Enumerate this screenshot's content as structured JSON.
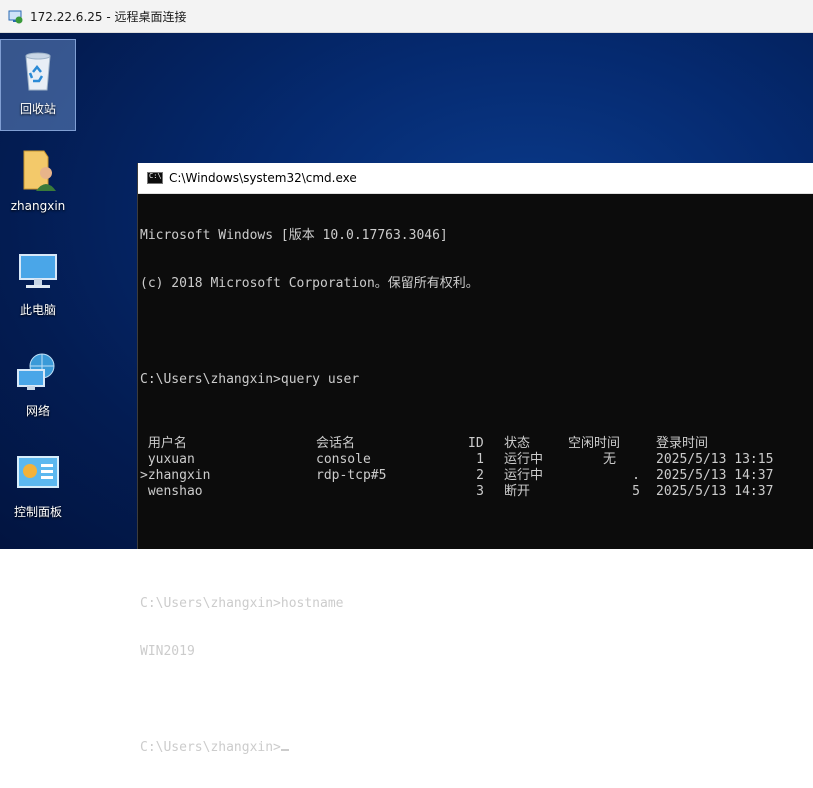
{
  "rdp": {
    "title": "172.22.6.25 - 远程桌面连接"
  },
  "desktop": {
    "icons": [
      {
        "label": "回收站",
        "icon": "recycle-bin-icon"
      },
      {
        "label": "zhangxin",
        "icon": "user-folder-icon"
      },
      {
        "label": "此电脑",
        "icon": "computer-icon"
      },
      {
        "label": "网络",
        "icon": "network-icon"
      },
      {
        "label": "控制面板",
        "icon": "control-panel-icon"
      }
    ]
  },
  "cmd": {
    "title": "C:\\Windows\\system32\\cmd.exe",
    "lines": {
      "version": "Microsoft Windows [版本 10.0.17763.3046]",
      "copyright": "(c) 2018 Microsoft Corporation。保留所有权利。",
      "cmd1": "C:\\Users\\zhangxin>query user",
      "cmd2": "C:\\Users\\zhangxin>hostname",
      "hostname_output": "WIN2019",
      "prompt": "C:\\Users\\zhangxin>"
    },
    "query_user": {
      "headers": {
        "username": " 用户名",
        "session": "会话名",
        "id": "ID",
        "state": "状态",
        "idle": "空闲时间",
        "logon": "登录时间"
      },
      "rows": [
        {
          "username": " yuxuan",
          "session": "console",
          "id": "1",
          "state": "运行中",
          "idle": "无",
          "logon": "2025/5/13 13:15"
        },
        {
          "username": ">zhangxin",
          "session": "rdp-tcp#5",
          "id": "2",
          "state": "运行中",
          "idle": ".",
          "logon": "2025/5/13 14:37"
        },
        {
          "username": " wenshao",
          "session": "",
          "id": "3",
          "state": "断开",
          "idle": "5",
          "logon": "2025/5/13 14:37"
        }
      ]
    }
  },
  "colors": {
    "console_bg": "#0c0c0c",
    "console_fg": "#cccccc",
    "desktop_bg": "#052a70"
  }
}
